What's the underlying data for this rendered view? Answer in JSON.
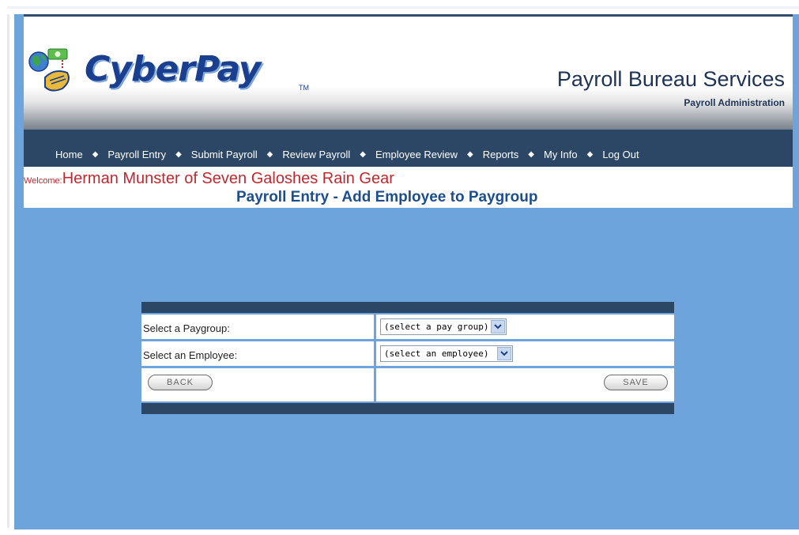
{
  "header": {
    "logo_text": "CyberPay",
    "logo_tm": "TM",
    "brand_title": "Payroll Bureau Services",
    "brand_subtitle": "Payroll Administration"
  },
  "nav": {
    "items": [
      "Home",
      "Payroll Entry",
      "Submit Payroll",
      "Review Payroll",
      "Employee Review",
      "Reports",
      "My Info",
      "Log Out"
    ],
    "separator": "◆"
  },
  "welcome": {
    "label": "Welcome:",
    "name": "Herman Munster of Seven Galoshes Rain Gear"
  },
  "page_title": "Payroll Entry - Add Employee to Paygroup",
  "form": {
    "paygroup_label": "Select a Paygroup:",
    "paygroup_value": "(select a pay group)",
    "employee_label": "Select an Employee:",
    "employee_value": "(select an employee)",
    "back_label": "BACK",
    "save_label": "SAVE"
  },
  "colors": {
    "page_bg": "#6ea4dc",
    "nav_bg": "#2c4766",
    "title": "#1c4e8f",
    "welcome": "#c2272d"
  },
  "icons": {
    "logo": "globe-money-phone-icon",
    "dropdown": "chevron-down-icon"
  }
}
